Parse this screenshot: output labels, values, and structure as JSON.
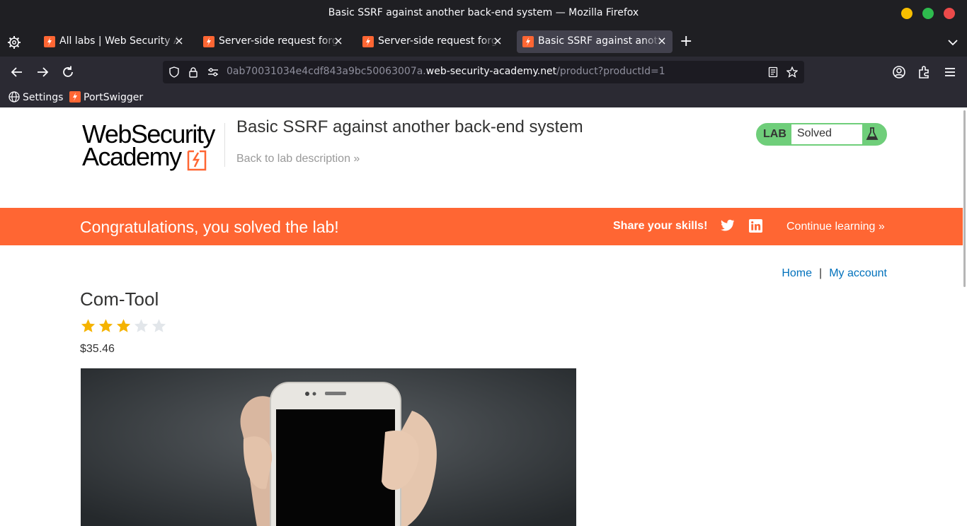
{
  "window": {
    "title": "Basic SSRF against another back-end system — Mozilla Firefox"
  },
  "tabs": [
    {
      "label": "All labs | Web Security Academy",
      "active": false
    },
    {
      "label": "Server-side request forgery",
      "active": false
    },
    {
      "label": "Server-side request forgery",
      "active": false
    },
    {
      "label": "Basic SSRF against another back-end system",
      "active": true
    }
  ],
  "address": {
    "prefix": "0ab70031034e4cdf843a9bc50063007a.",
    "host": "web-security-academy.net",
    "path": "/product?productId=1"
  },
  "bookmarks": [
    {
      "label": "Settings",
      "icon": "globe-icon"
    },
    {
      "label": "PortSwigger",
      "icon": "portswigger-icon"
    }
  ],
  "header": {
    "logo_line1": "WebSecurity",
    "logo_line2": "Academy",
    "lab_title": "Basic SSRF against another back-end system",
    "back_link": "Back to lab description »",
    "status_lab": "LAB",
    "status_state": "Solved"
  },
  "banner": {
    "message": "Congratulations, you solved the lab!",
    "share": "Share your skills!",
    "continue": "Continue learning »"
  },
  "nav": {
    "home": "Home",
    "separator": "|",
    "account": "My account"
  },
  "product": {
    "name": "Com-Tool",
    "rating": 3,
    "rating_max": 5,
    "price": "$35.46"
  },
  "colors": {
    "accent": "#ff6633",
    "solved_green": "#6fce7a",
    "star_on": "#f5b300",
    "star_off": "#e2e6ea",
    "link": "#0071bc"
  }
}
